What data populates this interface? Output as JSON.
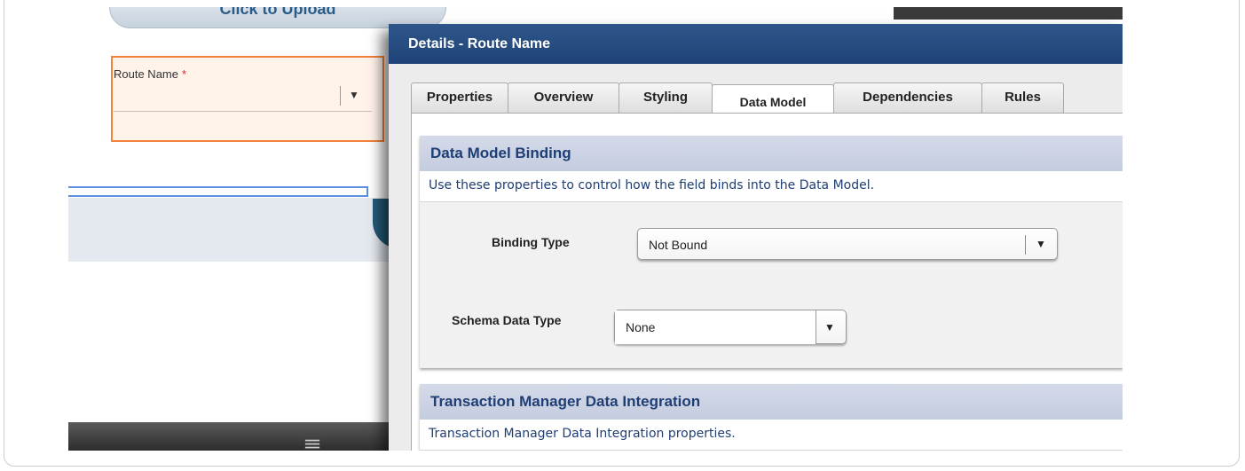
{
  "background_form": {
    "upload_label": "Click to Upload",
    "route_name_label": "Route Name",
    "required_mark": "*",
    "dropdown_arrow": "▼",
    "grip_glyph": "≡"
  },
  "dialog": {
    "title": "Details - Route Name",
    "tabs": [
      {
        "label": "Properties"
      },
      {
        "label": "Overview"
      },
      {
        "label": "Styling"
      },
      {
        "label": "Data Model",
        "active": true
      },
      {
        "label": "Dependencies"
      },
      {
        "label": "Rules"
      }
    ],
    "data_model_section": {
      "heading": "Data Model Binding",
      "description": "Use these properties to control how the field binds into the Data Model.",
      "binding_type_label": "Binding Type",
      "binding_type_value": "Not Bound",
      "schema_data_type_label": "Schema Data Type",
      "schema_data_type_value": "None",
      "dropdown_arrow": "▼"
    },
    "tm_section": {
      "heading": "Transaction Manager Data Integration",
      "description": "Transaction Manager Data Integration properties."
    }
  },
  "colors": {
    "dialog_title_bar": "#1f4378",
    "section_header": "#c8d0e2",
    "section_text": "#1f3e73",
    "highlight_border": "#f0823c",
    "required": "#d9232e"
  }
}
